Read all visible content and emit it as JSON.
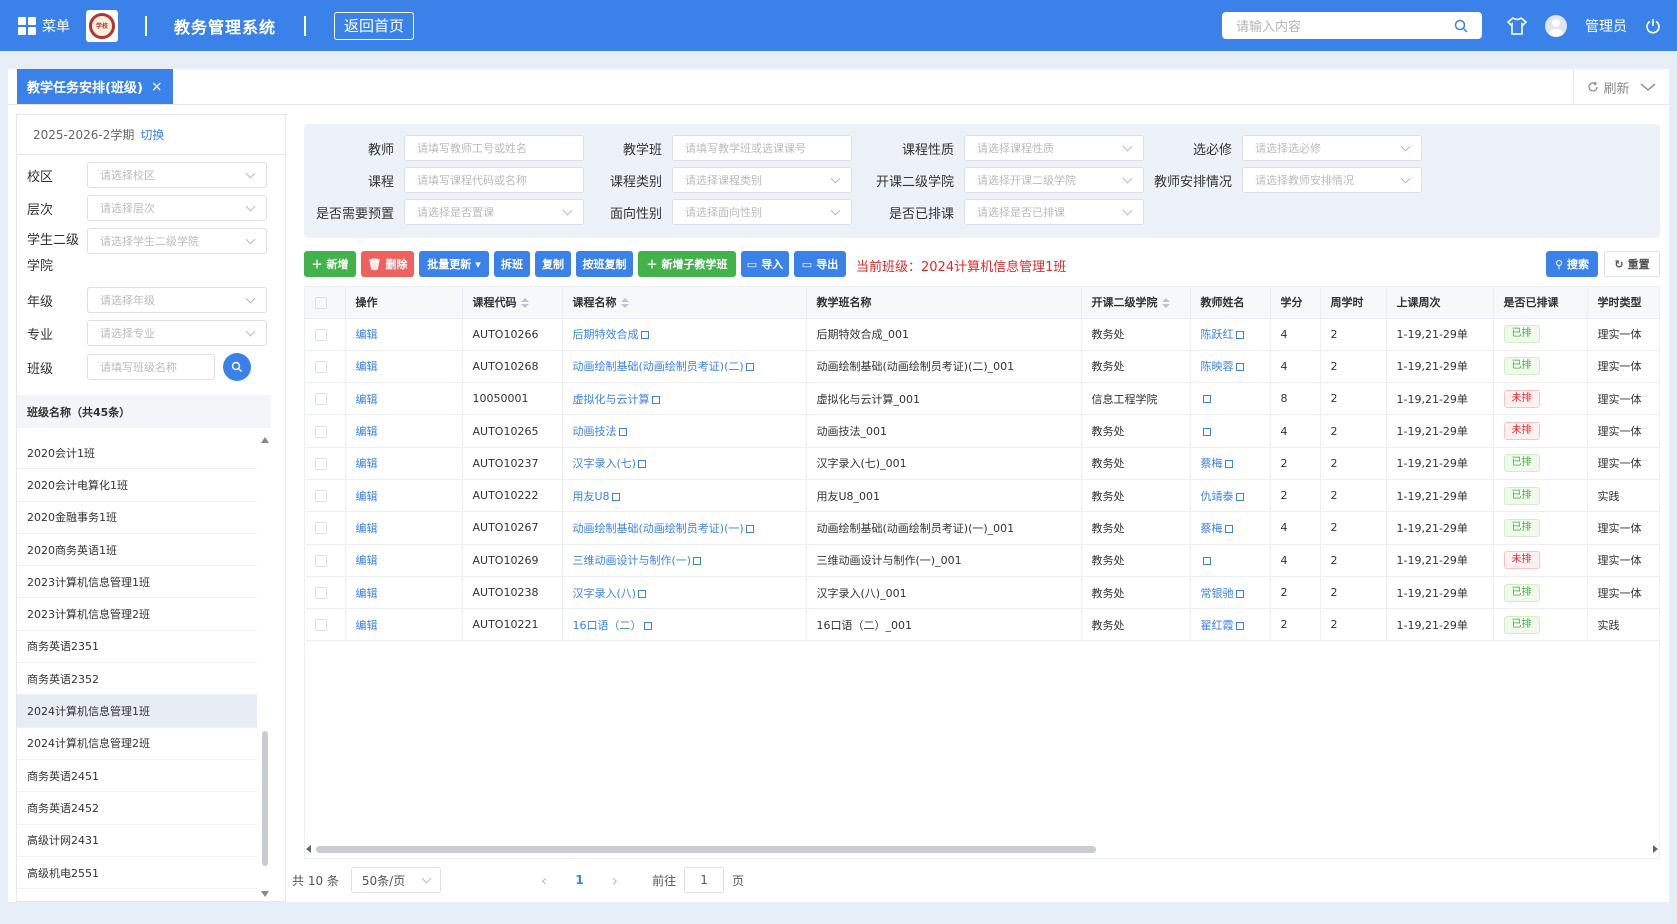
{
  "topbar": {
    "menu_label": "菜单",
    "logo_text": "学校",
    "system_title": "教务管理系统",
    "home_button": "返回首页",
    "search_placeholder": "请输入内容",
    "user_name": "管理员"
  },
  "tabs": {
    "active_label": "教学任务安排(班级)",
    "close": "×",
    "refresh_label": "刷新"
  },
  "left": {
    "term": "2025-2026-2学期",
    "switch": "切换",
    "fields": [
      {
        "label": "校区",
        "placeholder": "请选择校区"
      },
      {
        "label": "层次",
        "placeholder": "请选择层次"
      },
      {
        "label": "学生二级",
        "label2": "学院",
        "placeholder": "请选择学生二级学院"
      },
      {
        "label": "年级",
        "placeholder": "请选择年级"
      },
      {
        "label": "专业",
        "placeholder": "请选择专业"
      },
      {
        "label": "班级",
        "placeholder": "请填写班级名称"
      }
    ],
    "list_header": "班级名称（共45条）",
    "classes": [
      "2020会计1班",
      "2020会计电算化1班",
      "2020金融事务1班",
      "2020商务英语1班",
      "2023计算机信息管理1班",
      "2023计算机信息管理2班",
      "商务英语2351",
      "商务英语2352",
      "2024计算机信息管理1班",
      "2024计算机信息管理2班",
      "商务英语2451",
      "商务英语2452",
      "高级计网2431",
      "高级机电2551"
    ],
    "selected_class": "2024计算机信息管理1班"
  },
  "filters": [
    {
      "label": "教师",
      "placeholder": "请填写教师工号或姓名",
      "type": "input"
    },
    {
      "label": "教学班",
      "placeholder": "请填写教学班或选课课号",
      "type": "input"
    },
    {
      "label": "课程性质",
      "placeholder": "请选择课程性质",
      "type": "select"
    },
    {
      "label": "选必修",
      "placeholder": "请选择选必修",
      "type": "select"
    },
    {
      "label": "课程",
      "placeholder": "请填写课程代码或名称",
      "type": "input"
    },
    {
      "label": "课程类别",
      "placeholder": "请选择课程类别",
      "type": "select"
    },
    {
      "label": "开课二级学院",
      "placeholder": "请选择开课二级学院",
      "type": "select"
    },
    {
      "label": "教师安排情况",
      "placeholder": "请选择教师安排情况",
      "type": "select"
    },
    {
      "label": "是否需要预置",
      "placeholder": "请选择是否置课",
      "type": "select"
    },
    {
      "label": "面向性别",
      "placeholder": "请选择面向性别",
      "type": "select"
    },
    {
      "label": "是否已排课",
      "placeholder": "请选择是否已排课",
      "type": "select"
    }
  ],
  "toolbar": {
    "add": "新增",
    "delete": "删除",
    "batch_update": "批量更新",
    "split": "拆班",
    "copy": "复制",
    "copy_by_class": "按班复制",
    "add_sub": "新增子教学班",
    "import": "导入",
    "export": "导出",
    "current_class": "当前班级：2024计算机信息管理1班",
    "search": "搜索",
    "reset": "重置"
  },
  "table": {
    "headers": [
      "操作",
      "课程代码",
      "课程名称",
      "教学班名称",
      "开课二级学院",
      "教师姓名",
      "学分",
      "周学时",
      "上课周次",
      "是否已排课",
      "学时类型"
    ],
    "edit_label": "编辑",
    "rows": [
      {
        "code": "AUTO10266",
        "name": "后期特效合成",
        "class_name": "后期特效合成_001",
        "college": "教务处",
        "teacher": "陈跃红",
        "credit": "4",
        "hours": "2",
        "weeks": "1-19,21-29单",
        "scheduled": "已排",
        "status": "ok",
        "type": "理实一体"
      },
      {
        "code": "AUTO10268",
        "name": "动画绘制基础(动画绘制员考证)(二)",
        "class_name": "动画绘制基础(动画绘制员考证)(二)_001",
        "college": "教务处",
        "teacher": "陈映蓉",
        "credit": "4",
        "hours": "2",
        "weeks": "1-19,21-29单",
        "scheduled": "已排",
        "status": "ok",
        "type": "理实一体"
      },
      {
        "code": "10050001",
        "name": "虚拟化与云计算",
        "class_name": "虚拟化与云计算_001",
        "college": "信息工程学院",
        "teacher": "",
        "credit": "8",
        "hours": "2",
        "weeks": "1-19,21-29单",
        "scheduled": "未排",
        "status": "no",
        "type": "理实一体"
      },
      {
        "code": "AUTO10265",
        "name": "动画技法",
        "class_name": "动画技法_001",
        "college": "教务处",
        "teacher": "",
        "credit": "4",
        "hours": "2",
        "weeks": "1-19,21-29单",
        "scheduled": "未排",
        "status": "no",
        "type": "理实一体"
      },
      {
        "code": "AUTO10237",
        "name": "汉字录入(七)",
        "class_name": "汉字录入(七)_001",
        "college": "教务处",
        "teacher": "蔡梅",
        "credit": "2",
        "hours": "2",
        "weeks": "1-19,21-29单",
        "scheduled": "已排",
        "status": "ok",
        "type": "理实一体"
      },
      {
        "code": "AUTO10222",
        "name": "用友U8",
        "class_name": "用友U8_001",
        "college": "教务处",
        "teacher": "仇靖泰",
        "credit": "2",
        "hours": "2",
        "weeks": "1-19,21-29单",
        "scheduled": "已排",
        "status": "ok",
        "type": "实践"
      },
      {
        "code": "AUTO10267",
        "name": "动画绘制基础(动画绘制员考证)(一)",
        "class_name": "动画绘制基础(动画绘制员考证)(一)_001",
        "college": "教务处",
        "teacher": "蔡梅",
        "credit": "4",
        "hours": "2",
        "weeks": "1-19,21-29单",
        "scheduled": "已排",
        "status": "ok",
        "type": "理实一体"
      },
      {
        "code": "AUTO10269",
        "name": "三维动画设计与制作(一)",
        "class_name": "三维动画设计与制作(一)_001",
        "college": "教务处",
        "teacher": "",
        "credit": "4",
        "hours": "2",
        "weeks": "1-19,21-29单",
        "scheduled": "未排",
        "status": "no",
        "type": "理实一体"
      },
      {
        "code": "AUTO10238",
        "name": "汉字录入(八)",
        "class_name": "汉字录入(八)_001",
        "college": "教务处",
        "teacher": "常银驰",
        "credit": "2",
        "hours": "2",
        "weeks": "1-19,21-29单",
        "scheduled": "已排",
        "status": "ok",
        "type": "理实一体"
      },
      {
        "code": "AUTO10221",
        "name": "16口语（二）",
        "class_name": "16口语（二）_001",
        "college": "教务处",
        "teacher": "翟红霞",
        "credit": "2",
        "hours": "2",
        "weeks": "1-19,21-29单",
        "scheduled": "已排",
        "status": "ok",
        "type": "实践"
      }
    ]
  },
  "pager": {
    "total": "共 10 条",
    "page_size": "50条/页",
    "prev": "‹",
    "current": "1",
    "next": "›",
    "goto": "前往",
    "goto_value": "1",
    "page_suffix": "页"
  }
}
